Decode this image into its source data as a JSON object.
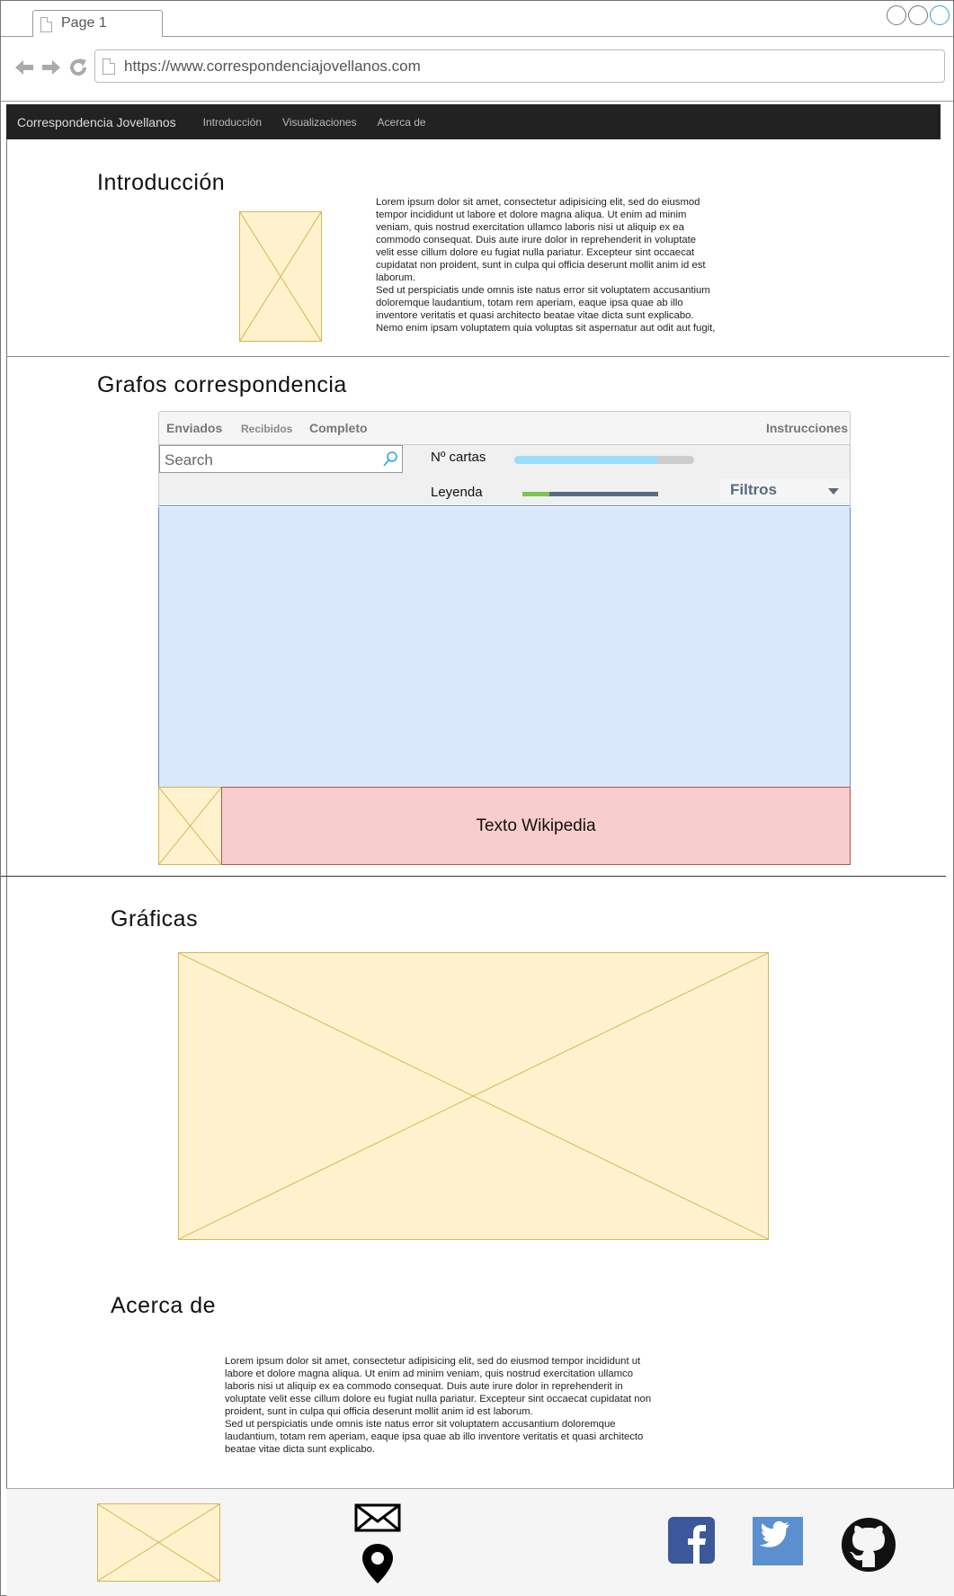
{
  "browser": {
    "tab_label": "Page 1",
    "url": "https://www.correspondenciajovellanos.com"
  },
  "nav": {
    "brand": "Correspondencia Jovellanos",
    "links": [
      "Introducción",
      "Visualizaciones",
      "Acerca de"
    ]
  },
  "intro": {
    "title": "Introducción",
    "paragraph1": "Lorem ipsum dolor sit amet, consectetur adipisicing elit, sed do eiusmod tempor incididunt ut labore et dolore magna aliqua. Ut enim ad minim veniam, quis nostrud exercitation ullamco laboris nisi ut aliquip ex ea commodo consequat. Duis aute irure dolor in reprehenderit in voluptate velit esse cillum dolore eu fugiat nulla pariatur. Excepteur sint occaecat cupidatat non proident, sunt in culpa qui officia deserunt mollit anim id est laborum.",
    "paragraph2": "Sed ut perspiciatis unde omnis iste natus error sit voluptatem accusantium doloremque laudantium, totam rem aperiam, eaque ipsa quae ab illo inventore veritatis et quasi architecto beatae vitae dicta sunt explicabo. Nemo enim ipsam voluptatem quia voluptas sit aspernatur aut odit aut fugit,"
  },
  "graphs": {
    "title": "Grafos correspondencia",
    "tabs": [
      "Enviados",
      "Recibidos",
      "Completo"
    ],
    "instructions": "Instrucciones",
    "search_placeholder": "Search",
    "letters_label": "Nº cartas",
    "letters_progress": 0.8,
    "legend_label": "Leyenda",
    "legend_progress": 0.2,
    "filters_label": "Filtros",
    "wiki_text": "Texto Wikipedia"
  },
  "charts": {
    "title": "Gráficas"
  },
  "about": {
    "title": "Acerca de",
    "paragraph1": "Lorem ipsum dolor sit amet, consectetur adipisicing elit, sed do eiusmod tempor incididunt ut labore et dolore magna aliqua. Ut enim ad minim veniam, quis nostrud exercitation ullamco laboris nisi ut aliquip ex ea commodo consequat. Duis aute irure dolor in reprehenderit in voluptate velit esse cillum dolore eu fugiat nulla pariatur. Excepteur sint occaecat cupidatat non proident, sunt in culpa qui officia deserunt mollit anim id est laborum.",
    "paragraph2": "Sed ut perspiciatis unde omnis iste natus error sit voluptatem accusantium doloremque laudantium, totam rem aperiam, eaque ipsa quae ab illo inventore veritatis et quasi architecto beatae vitae dicta sunt explicabo."
  },
  "footer": {
    "icons": [
      "mail-icon",
      "location-pin-icon",
      "facebook-icon",
      "twitter-icon",
      "github-icon"
    ]
  },
  "colors": {
    "nav_bg": "#222222",
    "placeholder_fill": "#fff2cc",
    "placeholder_stroke": "#d6b656",
    "canvas_fill": "#dae8fc",
    "wiki_fill": "#f8cecc",
    "facebook": "#3b5998",
    "twitter": "#5b8fcf"
  }
}
